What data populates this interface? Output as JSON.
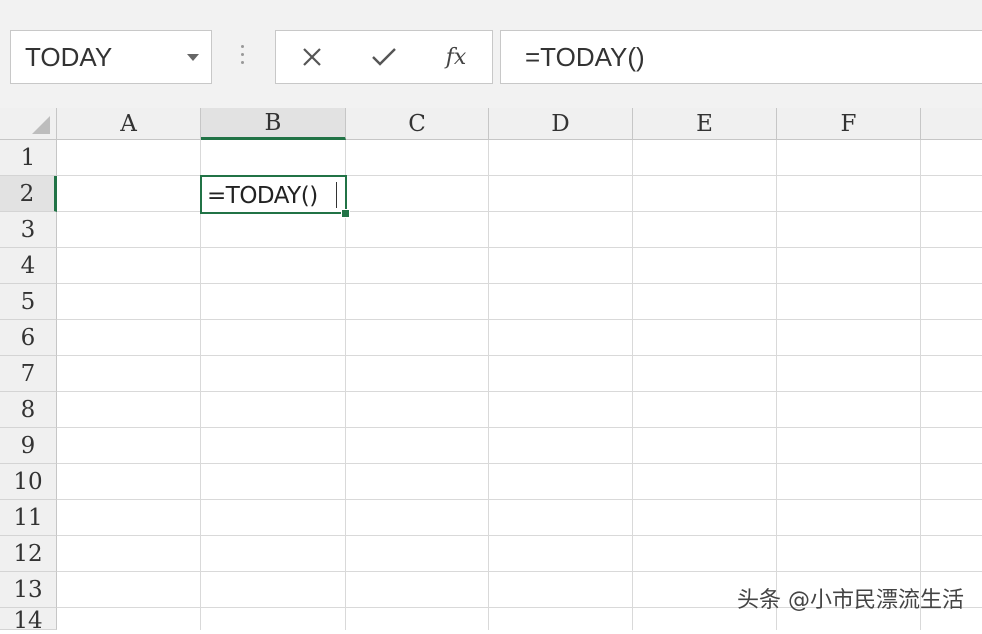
{
  "name_box": {
    "value": "TODAY"
  },
  "formula_buttons": {
    "cancel_icon": "×-icon",
    "enter_icon": "check-icon",
    "fx_label": "fx"
  },
  "formula_bar": {
    "value": "=TODAY()"
  },
  "columns": [
    "A",
    "B",
    "C",
    "D",
    "E",
    "F"
  ],
  "rows": [
    "1",
    "2",
    "3",
    "4",
    "5",
    "6",
    "7",
    "8",
    "9",
    "10",
    "11",
    "12",
    "13",
    "14"
  ],
  "active_cell": {
    "column": "B",
    "row": "2",
    "content": "=TODAY()"
  },
  "watermark": "头条 @小市民漂流生活",
  "colors": {
    "selection": "#217346"
  }
}
